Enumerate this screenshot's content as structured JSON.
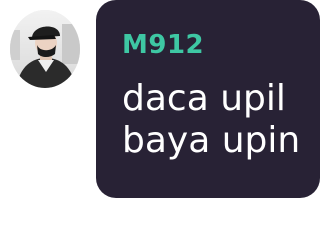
{
  "chat_message": {
    "sender": "M912",
    "lines": [
      "daca upil",
      "baya upin"
    ],
    "avatar": {
      "icon": "user-avatar-photo"
    }
  },
  "colors": {
    "bubble_background": "#282235",
    "sender_name": "#3ec7a3",
    "message_text": "#ffffff",
    "page_background": "#ffffff"
  }
}
